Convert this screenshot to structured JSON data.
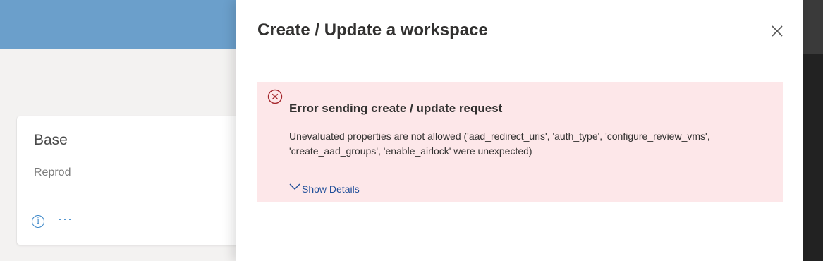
{
  "background": {
    "card": {
      "title": "Base",
      "subtitle": "Reprod",
      "info_icon_glyph": "i",
      "more_glyph": "···"
    }
  },
  "panel": {
    "title": "Create / Update a workspace",
    "close_icon": "close-icon"
  },
  "error": {
    "icon": "error-circle-icon",
    "title": "Error sending create / update request",
    "message": "Unevaluated properties are not allowed ('aad_redirect_uris', 'auth_type', 'configure_review_vms', 'create_aad_groups', 'enable_airlock' were unexpected)",
    "show_details_label": "Show Details"
  },
  "colors": {
    "header_blue": "#6b9fcb",
    "error_background": "#fde7e9",
    "error_icon": "#a4262c",
    "link": "#1f4e99"
  }
}
